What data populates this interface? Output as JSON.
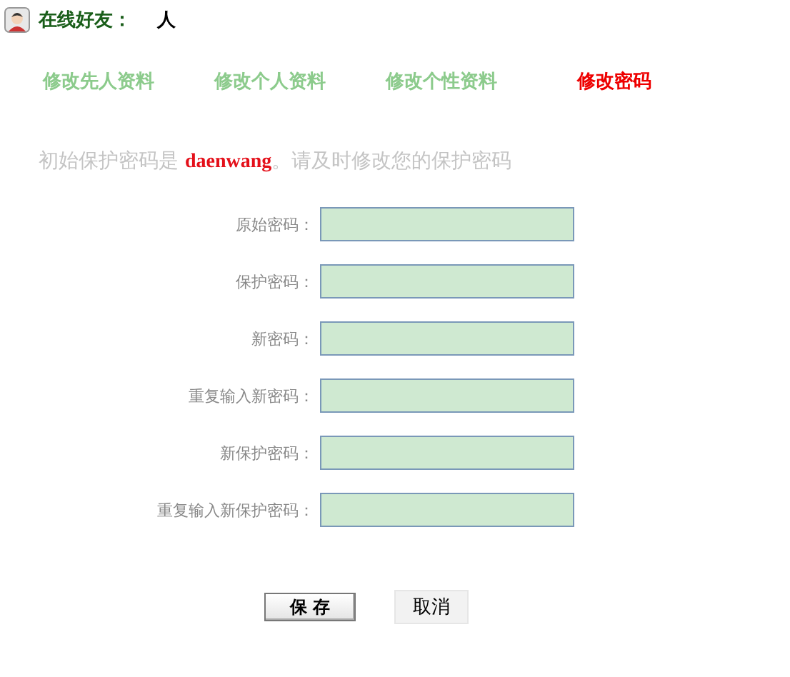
{
  "header": {
    "label": "在线好友：",
    "count": "人"
  },
  "tabs": [
    {
      "label": "修改先人资料",
      "selected": false
    },
    {
      "label": "修改个人资料",
      "selected": false
    },
    {
      "label": "修改个性资料",
      "selected": false
    },
    {
      "label": "修改密码",
      "selected": true
    }
  ],
  "notice": {
    "before": "初始保护密码是 ",
    "highlight": "daenwang",
    "after": "。请及时修改您的保护密码"
  },
  "fields": [
    {
      "label": "原始密码："
    },
    {
      "label": "保护密码："
    },
    {
      "label": "新密码："
    },
    {
      "label": "重复输入新密码："
    },
    {
      "label": "新保护密码："
    },
    {
      "label": "重复输入新保护密码："
    }
  ],
  "buttons": {
    "save": "保 存",
    "cancel": "取消"
  }
}
